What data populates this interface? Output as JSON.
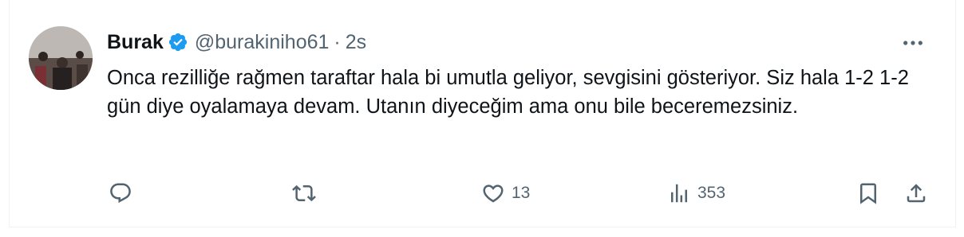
{
  "tweet": {
    "author_name": "Burak",
    "handle": "@burakiniho61",
    "separator": "·",
    "time": "2s",
    "text": "Onca rezilliğe rağmen taraftar hala bi umutla geliyor, sevgisini gösteriyor. Siz hala 1-2 1-2 gün diye oyalamaya devam. Utanın diyeceğim ama onu bile beceremezsiniz.",
    "verified": true,
    "verified_color": "#1d9bf0",
    "text_color": "#0f1419",
    "muted_color": "#536471"
  },
  "actions": {
    "reply": {
      "icon": "reply-icon"
    },
    "retweet": {
      "icon": "retweet-icon"
    },
    "like": {
      "icon": "heart-icon",
      "count": "13"
    },
    "views": {
      "icon": "views-icon",
      "count": "353"
    },
    "bookmark": {
      "icon": "bookmark-icon"
    },
    "share": {
      "icon": "share-icon"
    }
  }
}
